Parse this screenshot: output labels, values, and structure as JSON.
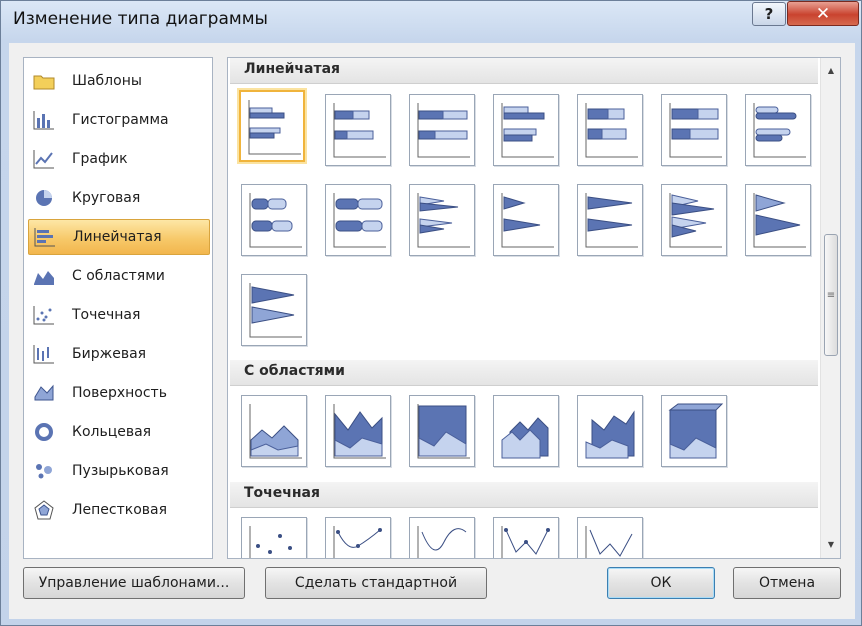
{
  "window": {
    "title": "Изменение типа диаграммы",
    "help_label": "?",
    "close_label": "✕"
  },
  "categories": [
    {
      "label": "Шаблоны",
      "icon": "folder-icon"
    },
    {
      "label": "Гистограмма",
      "icon": "column-chart-icon"
    },
    {
      "label": "График",
      "icon": "line-chart-icon"
    },
    {
      "label": "Круговая",
      "icon": "pie-chart-icon"
    },
    {
      "label": "Линейчатая",
      "icon": "bar-chart-icon",
      "selected": true
    },
    {
      "label": "С областями",
      "icon": "area-chart-icon"
    },
    {
      "label": "Точечная",
      "icon": "scatter-chart-icon"
    },
    {
      "label": "Биржевая",
      "icon": "stock-chart-icon"
    },
    {
      "label": "Поверхность",
      "icon": "surface-chart-icon"
    },
    {
      "label": "Кольцевая",
      "icon": "doughnut-chart-icon"
    },
    {
      "label": "Пузырьковая",
      "icon": "bubble-chart-icon"
    },
    {
      "label": "Лепестковая",
      "icon": "radar-chart-icon"
    }
  ],
  "sections": {
    "bar": "Линейчатая",
    "area": "С областями",
    "scatter": "Точечная"
  },
  "colors": {
    "accent_fill": "#5b74b3",
    "light_fill": "#c5d3ee",
    "selection": "#f2b64d"
  },
  "buttons": {
    "manage_templates": "Управление шаблонами...",
    "set_default": "Сделать стандартной",
    "ok": "ОК",
    "cancel": "Отмена"
  }
}
